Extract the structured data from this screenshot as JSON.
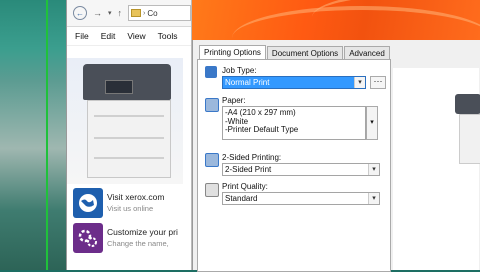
{
  "explorer": {
    "address_text": "Co",
    "menu": [
      "File",
      "Edit",
      "View",
      "Tools"
    ],
    "cards": [
      {
        "title": "Visit xerox.com",
        "subtitle": "Visit us online"
      },
      {
        "title": "Customize your pri",
        "subtitle": "Change the name,"
      }
    ]
  },
  "dialog": {
    "tabs": [
      "Printing Options",
      "Document Options",
      "Advanced"
    ],
    "job_type": {
      "label": "Job Type:",
      "value": "Normal Print",
      "more": "···"
    },
    "paper": {
      "label": "Paper:",
      "lines": [
        "-A4 (210 x 297 mm)",
        "-White",
        "-Printer Default Type"
      ]
    },
    "two_sided": {
      "label": "2-Sided Printing:",
      "value": "2-Sided Print"
    },
    "quality": {
      "label": "Print Quality:",
      "value": "Standard"
    }
  },
  "colors": {
    "accent_orange": "#ff5a12",
    "select_blue": "#3399ff",
    "desktop_green": "#1fc23a"
  }
}
